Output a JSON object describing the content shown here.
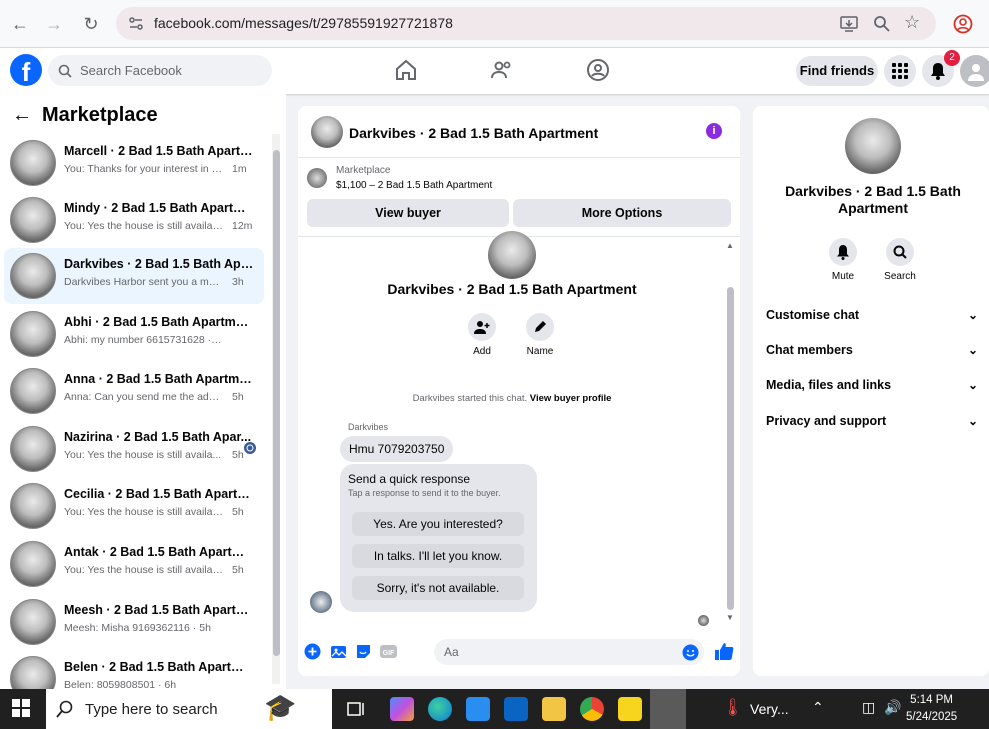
{
  "browser": {
    "url": "facebook.com/messages/t/29785591927721878"
  },
  "header": {
    "search_placeholder": "Search Facebook",
    "find_friends": "Find friends",
    "notification_count": "2"
  },
  "sidebar": {
    "title": "Marketplace",
    "conversations": [
      {
        "name": "Marcell · 2 Bad 1.5 Bath Apartm...",
        "preview": "You: Thanks for your interest in th...",
        "time": "1m"
      },
      {
        "name": "Mindy · 2 Bad 1.5 Bath Apartment",
        "preview": "You: Yes the house is still availabl...",
        "time": "12m"
      },
      {
        "name": "Darkvibes · 2 Bad 1.5 Bath Apart...",
        "preview": "Darkvibes Harbor sent you a mess...",
        "time": "3h"
      },
      {
        "name": "Abhi · 2 Bad 1.5 Bath Apartment",
        "preview": "Abhi: my number 6615731628 · 3h",
        "time": ""
      },
      {
        "name": "Anna · 2 Bad 1.5 Bath Apartment",
        "preview": "Anna: Can you send me the addres...",
        "time": "5h"
      },
      {
        "name": "Nazirina · 2 Bad 1.5 Bath Apar...",
        "preview": "You: Yes the house is still availa...",
        "time": "5h"
      },
      {
        "name": "Cecilia · 2 Bad 1.5 Bath Apartment",
        "preview": "You: Yes the house is still available ...",
        "time": "5h"
      },
      {
        "name": "Antak · 2 Bad 1.5 Bath Apartment",
        "preview": "You: Yes the house is still available ...",
        "time": "5h"
      },
      {
        "name": "Meesh · 2 Bad 1.5 Bath Apartme...",
        "preview": "Meesh: Misha 9169362116 · 5h",
        "time": ""
      },
      {
        "name": "Belen · 2 Bad 1.5 Bath Apartment",
        "preview": "Belen: 8059808501 · 6h",
        "time": ""
      }
    ]
  },
  "chat": {
    "title": "Darkvibes · 2 Bad 1.5 Bath Apartment",
    "marketplace_label": "Marketplace",
    "listing": "$1,100 – 2 Bad 1.5 Bath Apartment",
    "view_buyer": "View buyer",
    "more_options": "More Options",
    "body_title": "Darkvibes · 2 Bad 1.5 Bath Apartment",
    "add_label": "Add",
    "name_label": "Name",
    "started_text": "Darkvibes started this chat.",
    "view_profile": "View buyer profile",
    "sender": "Darkvibes",
    "message": "Hmu 7079203750",
    "quick_title": "Send a quick response",
    "quick_sub": "Tap a response to send it to the buyer.",
    "quick_options": [
      "Yes. Are you interested?",
      "In talks. I'll let you know.",
      "Sorry, it's not available."
    ],
    "composer_placeholder": "Aa"
  },
  "right_panel": {
    "title": "Darkvibes · 2 Bad 1.5 Bath Apartment",
    "mute": "Mute",
    "search": "Search",
    "sections": [
      "Customise chat",
      "Chat members",
      "Media, files and links",
      "Privacy and support"
    ]
  },
  "taskbar": {
    "search_placeholder": "Type here to search",
    "weather": "Very...",
    "time": "5:14 PM",
    "date": "5/24/2025"
  },
  "colors": {
    "brand": "#0866ff",
    "selected_row": "#ebf5ff",
    "badge": "#e41e3f",
    "info": "#8a2be2"
  }
}
